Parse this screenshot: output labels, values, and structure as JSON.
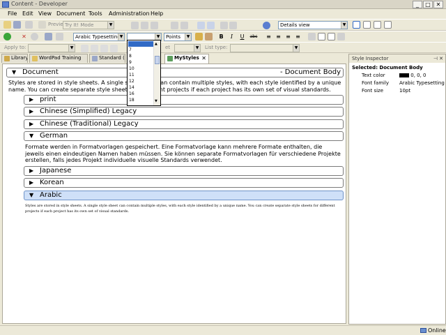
{
  "window": {
    "title": "Content - Developer",
    "controls": [
      "_",
      "□",
      "✕"
    ]
  },
  "menu": [
    "File",
    "Edit",
    "View",
    "Document",
    "Tools",
    "Administration",
    "Help"
  ],
  "toolbar1": {
    "preview_label": "Preview",
    "mode_value": "Try It! Mode",
    "view_value": "Details view"
  },
  "toolbar2": {
    "font_family": "Arabic Typesetting",
    "font_size": "",
    "size_unit": "Points",
    "bold": "B",
    "italic": "I",
    "underline": "U",
    "strike": "abc"
  },
  "toolbar3": {
    "apply_to": "Apply to:",
    "set_label": "et",
    "list_type": "List type:"
  },
  "size_dropdown": [
    "",
    "7",
    "8",
    "9",
    "10",
    "11",
    "12",
    "14",
    "16",
    "18"
  ],
  "tabs": [
    "Library",
    "WordPad Training",
    "Standard (R",
    "MyStyles"
  ],
  "document": {
    "header_left": "Document",
    "header_right": "- Document Body",
    "intro": "Styles are stored in style sheets. A single style sheet can contain multiple styles, with each style identified by a unique name. You can create separate style sheets for different projects if each project has its own set of visual standards.",
    "sections": [
      {
        "label": "print",
        "expanded": false
      },
      {
        "label": "Chinese (Simplified) Legacy",
        "expanded": false
      },
      {
        "label": "Chinese (Traditional) Legacy",
        "expanded": false
      },
      {
        "label": "German",
        "expanded": true,
        "text": "Formate werden in Formatvorlagen gespeichert. Eine Formatvorlage kann mehrere Formate enthalten, die jeweils einen eindeutigen Namen haben müssen. Sie können separate Formatvorlagen für verschiedene Projekte erstellen, falls jedes Projekt individuelle visuelle Standards verwendet."
      },
      {
        "label": "Japanese",
        "expanded": false
      },
      {
        "label": "Korean",
        "expanded": false
      },
      {
        "label": "Arabic",
        "expanded": true,
        "text": "Styles are stored in style sheets. A single style sheet can contain multiple styles, with each style identified by a unique name. You can create separate style sheets for different projects if each project has its own set of visual standards."
      }
    ]
  },
  "inspector": {
    "title": "Style Inspector",
    "selected": "Selected: Document Body",
    "rows": [
      {
        "label": "Text color",
        "value": "0, 0, 0"
      },
      {
        "label": "Font family",
        "value": "Arabic Typesetting"
      },
      {
        "label": "Font size",
        "value": "10pt"
      }
    ]
  },
  "status": {
    "online": "Online"
  },
  "colors": {
    "accent": "#316ac5",
    "selected_section": "#cfe0f8"
  }
}
